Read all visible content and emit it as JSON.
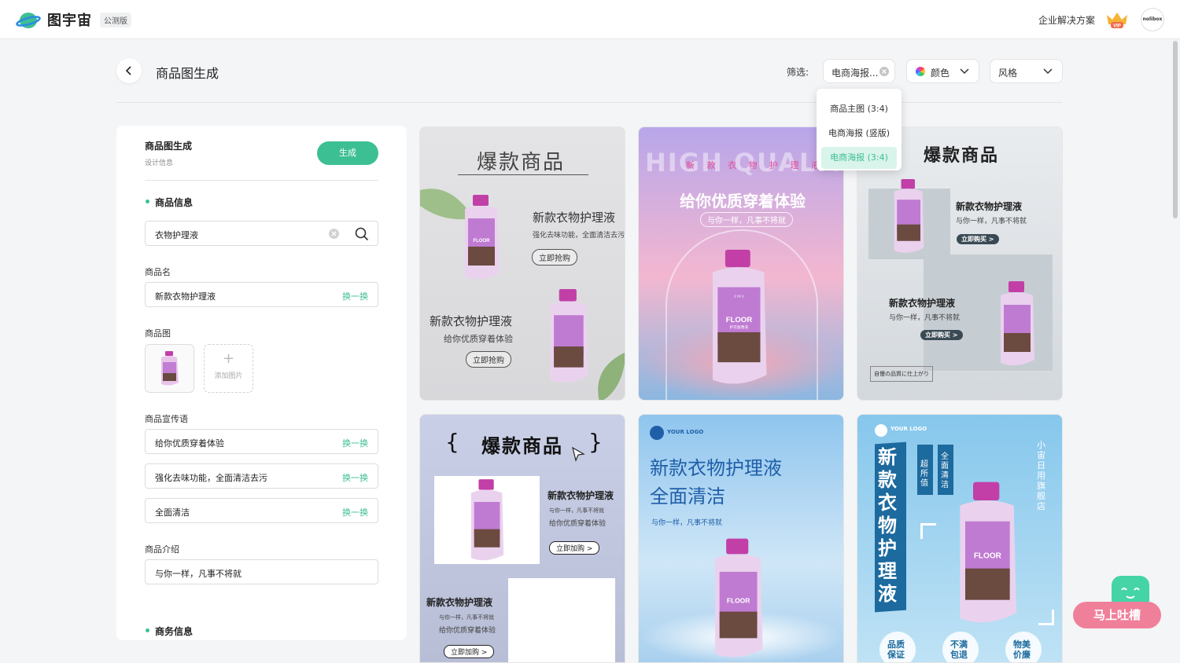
{
  "topbar": {
    "brand": "图宇宙",
    "beta_badge": "公测版",
    "enterprise_link": "企业解决方案",
    "vip_badge": "VIP",
    "avatar_text": "nolibox"
  },
  "header": {
    "title": "商品图生成",
    "filter_label": "筛选:",
    "filters": {
      "type_value": "电商海报...",
      "color_label": "颜色",
      "style_label": "风格"
    }
  },
  "dropdown": {
    "options": [
      "商品主图 (3:4)",
      "电商海报 (竖版)",
      "电商海报 (3:4)"
    ],
    "selected": "电商海报 (3:4)"
  },
  "panel": {
    "title": "商品图生成",
    "subtitle": "设计信息",
    "generate_label": "生成",
    "section_product": "商品信息",
    "search_value": "衣物护理液",
    "product_name_label": "商品名",
    "product_name_value": "新款衣物护理液",
    "swap_label": "换一换",
    "product_image_label": "商品图",
    "add_image_label": "添加图片",
    "slogan_label": "商品宣传语",
    "slogans": [
      "给你优质穿着体验",
      "强化去味功能，全面清洁去污",
      "全面清洁"
    ],
    "intro_label": "商品介绍",
    "intro_value": "与你一样，凡事不将就",
    "section_business": "商务信息"
  },
  "cards": {
    "c1": {
      "headline": "爆款商品",
      "name": "新款衣物护理液",
      "sub": "强化去味功能，全面清洁去污",
      "cta": "立即抢购",
      "name2": "新款衣物护理液",
      "sub2": "给你优质穿着体验",
      "cta2": "立即抢购"
    },
    "c2": {
      "bg_text": "HIGH QUALITY",
      "small": "新 款 衣 物 护 理 液",
      "headline": "给你优质穿着体验",
      "sub": "与你一样，凡事不将就"
    },
    "c3": {
      "headline": "爆款商品",
      "name": "新款衣物护理液",
      "sub": "与你一样，凡事不将就",
      "cta": "立即购买 >",
      "name2": "新款衣物护理液",
      "sub2": "与你一样，凡事不将就",
      "cta2": "立即购买 >",
      "tag": "自慢の品質に仕上がり"
    },
    "c4": {
      "brace_l": "{",
      "headline": "爆款商品",
      "brace_r": "}",
      "name": "新款衣物护理液",
      "sub": "与你一样，凡事不将就",
      "sub_b": "给你优质穿着体验",
      "cta": "立即加购 >",
      "name2": "新款衣物护理液",
      "sub2": "与你一样，凡事不将就",
      "sub2_b": "给你优质穿着体验",
      "cta2": "立即加购 >"
    },
    "c5": {
      "logo": "YOUR LOGO",
      "line1": "新款衣物护理液",
      "line2": "全面清洁",
      "sub": "与你一样，凡事不将就"
    },
    "c6": {
      "logo": "YOUR LOGO",
      "vertical": "新款衣物护理液",
      "tag1": "超所值",
      "tag2": "全面清洁",
      "store": "小宙日用旗舰店",
      "badge1": "品质保证",
      "badge2": "不满包退",
      "badge3": "物美价廉"
    },
    "bottle_brand": "FLOOR",
    "bottle_sub": "护衣留香洗",
    "bottle_tag": "2 IN 1"
  },
  "feedback": {
    "label": "马上吐槽"
  }
}
